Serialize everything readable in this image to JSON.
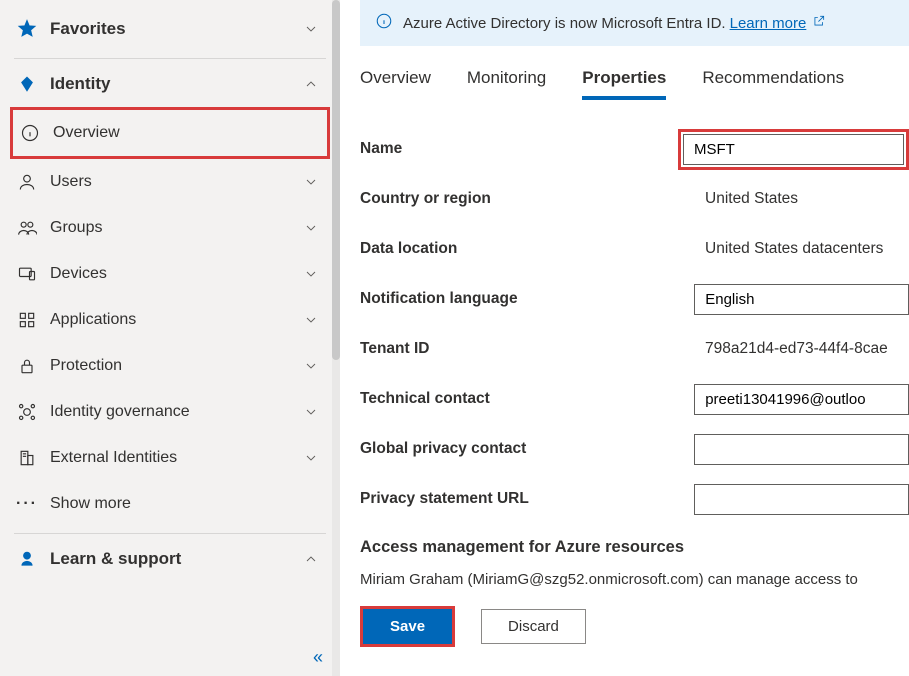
{
  "sidebar": {
    "favorites": {
      "label": "Favorites"
    },
    "identity": {
      "label": "Identity",
      "items": [
        {
          "label": "Overview"
        },
        {
          "label": "Users"
        },
        {
          "label": "Groups"
        },
        {
          "label": "Devices"
        },
        {
          "label": "Applications"
        },
        {
          "label": "Protection"
        },
        {
          "label": "Identity governance"
        },
        {
          "label": "External Identities"
        },
        {
          "label": "Show more"
        }
      ]
    },
    "learn": {
      "label": "Learn & support"
    }
  },
  "banner": {
    "text": "Azure Active Directory is now Microsoft Entra ID.",
    "link": "Learn more"
  },
  "tabs": [
    {
      "label": "Overview"
    },
    {
      "label": "Monitoring"
    },
    {
      "label": "Properties"
    },
    {
      "label": "Recommendations"
    }
  ],
  "form": {
    "name": {
      "label": "Name",
      "value": "MSFT"
    },
    "country": {
      "label": "Country or region",
      "value": "United States"
    },
    "datalocation": {
      "label": "Data location",
      "value": "United States datacenters"
    },
    "notificationlang": {
      "label": "Notification language",
      "value": "English"
    },
    "tenantid": {
      "label": "Tenant ID",
      "value": "798a21d4-ed73-44f4-8cae"
    },
    "techcontact": {
      "label": "Technical contact",
      "value": "preeti13041996@outloo"
    },
    "globalprivacy": {
      "label": "Global privacy contact",
      "value": ""
    },
    "privacyurl": {
      "label": "Privacy statement URL",
      "value": ""
    }
  },
  "access": {
    "title": "Access management for Azure resources",
    "desc": "Miriam Graham (MiriamG@szg52.onmicrosoft.com) can manage access to"
  },
  "buttons": {
    "save": "Save",
    "discard": "Discard"
  }
}
